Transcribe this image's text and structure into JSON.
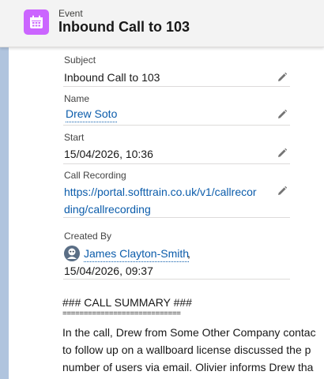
{
  "header": {
    "icon": "calendar-icon",
    "icon_color": "#cb65ff",
    "record_type": "Event",
    "title": "Inbound Call to 103"
  },
  "fields": {
    "subject": {
      "label": "Subject",
      "value": "Inbound Call to 103"
    },
    "name": {
      "label": "Name",
      "value": "Drew Soto"
    },
    "start": {
      "label": "Start",
      "value": "15/04/2026, 10:36"
    },
    "call_recording": {
      "label": "Call Recording",
      "value_line1": "https://portal.softtrain.co.uk/v1/callrecor",
      "value_line2": "ding/callrecording"
    },
    "created_by": {
      "label": "Created By",
      "user": "James Clayton-Smith",
      "separator": ",",
      "date": "15/04/2026, 09:37"
    }
  },
  "summary": {
    "heading": "### CALL SUMMARY ###",
    "rule": "============================",
    "lines": [
      "In the call, Drew from Some Other Company contac",
      "to follow up on a wallboard license discussed the p",
      "number of users via email. Olivier informs Drew tha"
    ]
  },
  "colors": {
    "link": "#0b5cab",
    "rail": "#b0c4de"
  }
}
